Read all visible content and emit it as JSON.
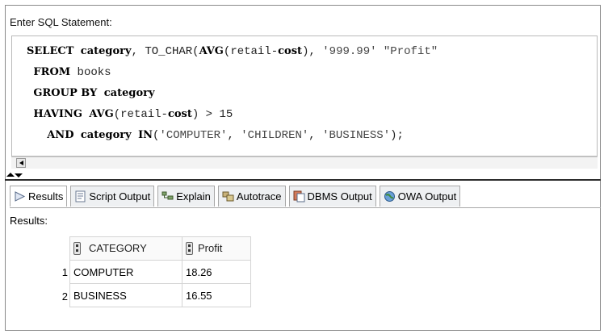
{
  "editor": {
    "label": "Enter SQL Statement:",
    "lines": [
      [
        {
          "t": "SELECT",
          "c": "kw"
        },
        {
          "t": " "
        },
        {
          "t": "category",
          "c": "kw"
        },
        {
          "t": ", TO_CHAR("
        },
        {
          "t": "AVG",
          "c": "kw"
        },
        {
          "t": "(retail-"
        },
        {
          "t": "cost",
          "c": "kw"
        },
        {
          "t": "), "
        },
        {
          "t": "'999.99'",
          "c": "str"
        },
        {
          "t": " "
        },
        {
          "t": "\"Profit\"",
          "c": "str"
        }
      ],
      [
        {
          "t": " "
        },
        {
          "t": "FROM",
          "c": "kw"
        },
        {
          "t": " books"
        }
      ],
      [
        {
          "t": " "
        },
        {
          "t": "GROUP BY",
          "c": "kw"
        },
        {
          "t": " "
        },
        {
          "t": "category",
          "c": "kw"
        }
      ],
      [
        {
          "t": " "
        },
        {
          "t": "HAVING",
          "c": "kw"
        },
        {
          "t": " "
        },
        {
          "t": "AVG",
          "c": "kw"
        },
        {
          "t": "(retail-"
        },
        {
          "t": "cost",
          "c": "kw"
        },
        {
          "t": ") > 15"
        }
      ],
      [
        {
          "t": "   "
        },
        {
          "t": "AND",
          "c": "kw"
        },
        {
          "t": " "
        },
        {
          "t": "category",
          "c": "kw"
        },
        {
          "t": " "
        },
        {
          "t": "IN",
          "c": "kw"
        },
        {
          "t": "("
        },
        {
          "t": "'COMPUTER'",
          "c": "str"
        },
        {
          "t": ", "
        },
        {
          "t": "'CHILDREN'",
          "c": "str"
        },
        {
          "t": ", "
        },
        {
          "t": "'BUSINESS'",
          "c": "str"
        },
        {
          "t": ");"
        }
      ]
    ]
  },
  "tabs": [
    {
      "label": "Results",
      "icon": "play-icon",
      "active": true
    },
    {
      "label": "Script Output",
      "icon": "script-icon",
      "active": false
    },
    {
      "label": "Explain",
      "icon": "explain-icon",
      "active": false
    },
    {
      "label": "Autotrace",
      "icon": "autotrace-icon",
      "active": false
    },
    {
      "label": "DBMS Output",
      "icon": "dbms-icon",
      "active": false
    },
    {
      "label": "OWA Output",
      "icon": "globe-icon",
      "active": false
    }
  ],
  "results": {
    "label": "Results:",
    "columns": [
      "CATEGORY",
      "Profit"
    ],
    "rows": [
      {
        "num": "1",
        "category": "COMPUTER",
        "profit": "18.26"
      },
      {
        "num": "2",
        "category": "BUSINESS",
        "profit": "16.55"
      }
    ]
  },
  "colors": {
    "tab_bg": "#eef0f2",
    "border": "#a8a8a8"
  }
}
